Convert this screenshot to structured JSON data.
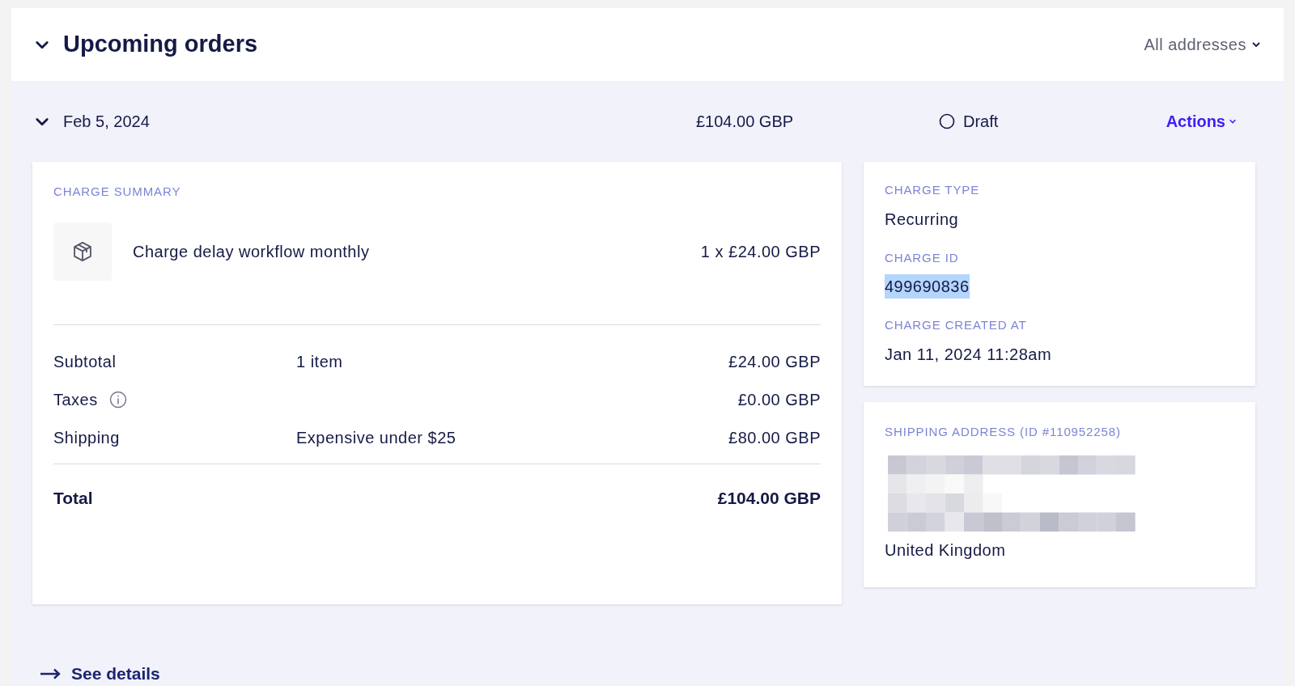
{
  "header": {
    "title": "Upcoming orders",
    "expanded": true,
    "filter": "All addresses"
  },
  "order": {
    "date": "Feb 5, 2024",
    "expanded": true,
    "amount": "£104.00 GBP",
    "status": "Draft",
    "actions": "Actions"
  },
  "charge_summary": {
    "heading": "CHARGE SUMMARY",
    "items": [
      {
        "name": "Charge delay workflow monthly",
        "quantity_price": "1 x £24.00 GBP"
      }
    ],
    "lines": [
      {
        "label": "Subtotal",
        "detail": "1 item",
        "amount": "£24.00 GBP",
        "info": false
      },
      {
        "label": "Taxes",
        "amount": "£0.00 GBP",
        "info": true
      },
      {
        "label": "Shipping",
        "detail": "Expensive under $25",
        "amount": "£80.00 GBP",
        "info": false
      }
    ],
    "total": {
      "label": "Total",
      "amount": "£104.00 GBP"
    }
  },
  "charge_details": [
    {
      "label": "CHARGE TYPE",
      "value": "Recurring",
      "highlighted": false
    },
    {
      "label": "CHARGE ID",
      "value": "499690836",
      "highlighted": true
    },
    {
      "label": "CHARGE CREATED AT",
      "value": "Jan 11, 2024 11:28am",
      "highlighted": false
    }
  ],
  "shipping_address": {
    "heading": "SHIPPING ADDRESS (ID #110952258)",
    "country": "United Kingdom"
  },
  "see_details": "See details"
}
